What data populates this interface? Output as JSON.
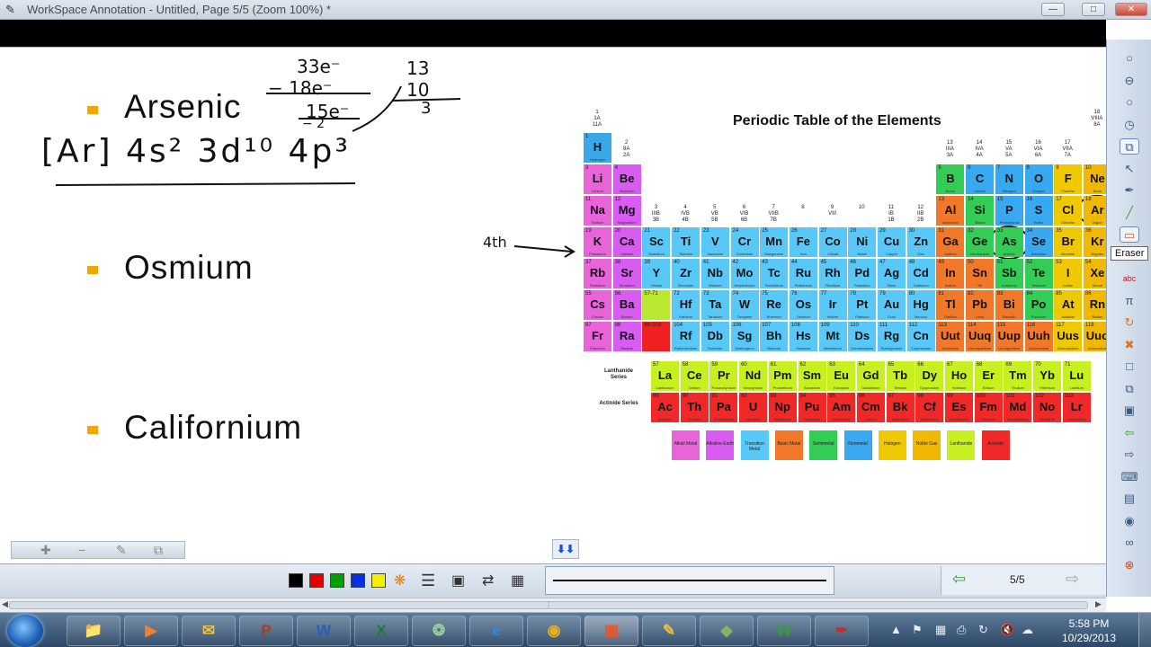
{
  "window": {
    "title": "WorkSpace Annotation - Untitled, Page 5/5  (Zoom 100%) *",
    "minimize": "—",
    "maximize": "□",
    "close": "✕"
  },
  "slide": {
    "bullets": [
      {
        "label": "Arsenic"
      },
      {
        "label": "Osmium"
      },
      {
        "label": "Californium"
      }
    ],
    "handwriting": {
      "calc_line1": "33e⁻",
      "calc_line2": "− 18e⁻",
      "calc_line3": "15e⁻",
      "calc_line4": "− 2",
      "group_line1": "13",
      "group_line2": "10",
      "group_line3": "3",
      "config": "[Ar] 4s² 3d¹⁰ 4p³",
      "period_mark": "4th"
    }
  },
  "periodic_table": {
    "title": "Periodic Table of the Elements",
    "group_labels": [
      {
        "g": "1\n1A\n11A"
      },
      {
        "g": "2\n8A\n2A"
      },
      {
        "g": "3\nIIIB\n3B"
      },
      {
        "g": "4\nIVB\n4B"
      },
      {
        "g": "5\nVB\n5B"
      },
      {
        "g": "6\nVIB\n6B"
      },
      {
        "g": "7\nVIIB\n7B"
      },
      {
        "g": "8"
      },
      {
        "g": "9\nVIII"
      },
      {
        "g": "10"
      },
      {
        "g": "11\nIB\n1B"
      },
      {
        "g": "12\nIIB\n2B"
      },
      {
        "g": "13\nIIIA\n3A"
      },
      {
        "g": "14\nIVA\n4A"
      },
      {
        "g": "15\nVA\n5A"
      },
      {
        "g": "16\nVIA\n6A"
      },
      {
        "g": "17\nVIIA\n7A"
      },
      {
        "g": "18\nVIIIA\n8A"
      }
    ],
    "elements": [
      {
        "n": "1",
        "s": "H",
        "name": "Hydrogen",
        "c": "#38a8e8"
      },
      {
        "n": "3",
        "s": "Li",
        "name": "Lithium",
        "c": "#e864d8"
      },
      {
        "n": "4",
        "s": "Be",
        "name": "Beryllium",
        "c": "#d85cf0"
      },
      {
        "n": "5",
        "s": "B",
        "name": "Boron",
        "c": "#33cc55"
      },
      {
        "n": "6",
        "s": "C",
        "name": "Carbon",
        "c": "#38a8f0"
      },
      {
        "n": "7",
        "s": "N",
        "name": "Nitrogen",
        "c": "#38a8f0"
      },
      {
        "n": "8",
        "s": "O",
        "name": "Oxygen",
        "c": "#38a8f0"
      },
      {
        "n": "9",
        "s": "F",
        "name": "Fluorine",
        "c": "#f0c800"
      },
      {
        "n": "10",
        "s": "Ne",
        "name": "Neon",
        "c": "#f0b800"
      },
      {
        "n": "11",
        "s": "Na",
        "name": "Sodium",
        "c": "#e864d8"
      },
      {
        "n": "12",
        "s": "Mg",
        "name": "Magnesium",
        "c": "#d85cf0"
      },
      {
        "n": "13",
        "s": "Al",
        "name": "Aluminum",
        "c": "#f07828"
      },
      {
        "n": "14",
        "s": "Si",
        "name": "Silicon",
        "c": "#33cc55"
      },
      {
        "n": "15",
        "s": "P",
        "name": "Phosphorus",
        "c": "#38a8f0"
      },
      {
        "n": "16",
        "s": "S",
        "name": "Sulfur",
        "c": "#38a8f0"
      },
      {
        "n": "17",
        "s": "Cl",
        "name": "Chlorine",
        "c": "#f0c800"
      },
      {
        "n": "18",
        "s": "Ar",
        "name": "Argon",
        "c": "#f0b800"
      },
      {
        "n": "19",
        "s": "K",
        "name": "Potassium",
        "c": "#e864d8"
      },
      {
        "n": "20",
        "s": "Ca",
        "name": "Calcium",
        "c": "#d85cf0"
      },
      {
        "n": "21",
        "s": "Sc",
        "name": "Scandium",
        "c": "#58c8f8"
      },
      {
        "n": "22",
        "s": "Ti",
        "name": "Titanium",
        "c": "#58c8f8"
      },
      {
        "n": "23",
        "s": "V",
        "name": "Vanadium",
        "c": "#58c8f8"
      },
      {
        "n": "24",
        "s": "Cr",
        "name": "Chromium",
        "c": "#58c8f8"
      },
      {
        "n": "25",
        "s": "Mn",
        "name": "Manganese",
        "c": "#58c8f8"
      },
      {
        "n": "26",
        "s": "Fe",
        "name": "Iron",
        "c": "#58c8f8"
      },
      {
        "n": "27",
        "s": "Co",
        "name": "Cobalt",
        "c": "#58c8f8"
      },
      {
        "n": "28",
        "s": "Ni",
        "name": "Nickel",
        "c": "#58c8f8"
      },
      {
        "n": "29",
        "s": "Cu",
        "name": "Copper",
        "c": "#58c8f8"
      },
      {
        "n": "30",
        "s": "Zn",
        "name": "Zinc",
        "c": "#58c8f8"
      },
      {
        "n": "31",
        "s": "Ga",
        "name": "Gallium",
        "c": "#f07828"
      },
      {
        "n": "32",
        "s": "Ge",
        "name": "Germanium",
        "c": "#33cc55"
      },
      {
        "n": "33",
        "s": "As",
        "name": "Arsenic",
        "c": "#33cc55"
      },
      {
        "n": "34",
        "s": "Se",
        "name": "Selenium",
        "c": "#38a8f0"
      },
      {
        "n": "35",
        "s": "Br",
        "name": "Bromine",
        "c": "#f0c800"
      },
      {
        "n": "36",
        "s": "Kr",
        "name": "Krypton",
        "c": "#f0b800"
      },
      {
        "n": "37",
        "s": "Rb",
        "name": "Rubidium",
        "c": "#e864d8"
      },
      {
        "n": "38",
        "s": "Sr",
        "name": "Strontium",
        "c": "#d85cf0"
      },
      {
        "n": "39",
        "s": "Y",
        "name": "Yttrium",
        "c": "#58c8f8"
      },
      {
        "n": "40",
        "s": "Zr",
        "name": "Zirconium",
        "c": "#58c8f8"
      },
      {
        "n": "41",
        "s": "Nb",
        "name": "Niobium",
        "c": "#58c8f8"
      },
      {
        "n": "42",
        "s": "Mo",
        "name": "Molybdenum",
        "c": "#58c8f8"
      },
      {
        "n": "43",
        "s": "Tc",
        "name": "Technetium",
        "c": "#58c8f8"
      },
      {
        "n": "44",
        "s": "Ru",
        "name": "Ruthenium",
        "c": "#58c8f8"
      },
      {
        "n": "45",
        "s": "Rh",
        "name": "Rhodium",
        "c": "#58c8f8"
      },
      {
        "n": "46",
        "s": "Pd",
        "name": "Palladium",
        "c": "#58c8f8"
      },
      {
        "n": "47",
        "s": "Ag",
        "name": "Silver",
        "c": "#58c8f8"
      },
      {
        "n": "48",
        "s": "Cd",
        "name": "Cadmium",
        "c": "#58c8f8"
      },
      {
        "n": "49",
        "s": "In",
        "name": "Indium",
        "c": "#f07828"
      },
      {
        "n": "50",
        "s": "Sn",
        "name": "Tin",
        "c": "#f07828"
      },
      {
        "n": "51",
        "s": "Sb",
        "name": "Antimony",
        "c": "#33cc55"
      },
      {
        "n": "52",
        "s": "Te",
        "name": "Tellurium",
        "c": "#33cc55"
      },
      {
        "n": "53",
        "s": "I",
        "name": "Iodine",
        "c": "#f0c800"
      },
      {
        "n": "54",
        "s": "Xe",
        "name": "Xenon",
        "c": "#f0b800"
      },
      {
        "n": "55",
        "s": "Cs",
        "name": "Cesium",
        "c": "#e864d8"
      },
      {
        "n": "56",
        "s": "Ba",
        "name": "Barium",
        "c": "#d85cf0"
      },
      {
        "n": "57-71",
        "s": "",
        "name": "",
        "c": "#b8e830"
      },
      {
        "n": "72",
        "s": "Hf",
        "name": "Hafnium",
        "c": "#58c8f8"
      },
      {
        "n": "73",
        "s": "Ta",
        "name": "Tantalum",
        "c": "#58c8f8"
      },
      {
        "n": "74",
        "s": "W",
        "name": "Tungsten",
        "c": "#58c8f8"
      },
      {
        "n": "75",
        "s": "Re",
        "name": "Rhenium",
        "c": "#58c8f8"
      },
      {
        "n": "76",
        "s": "Os",
        "name": "Osmium",
        "c": "#58c8f8"
      },
      {
        "n": "77",
        "s": "Ir",
        "name": "Iridium",
        "c": "#58c8f8"
      },
      {
        "n": "78",
        "s": "Pt",
        "name": "Platinum",
        "c": "#58c8f8"
      },
      {
        "n": "79",
        "s": "Au",
        "name": "Gold",
        "c": "#58c8f8"
      },
      {
        "n": "80",
        "s": "Hg",
        "name": "Mercury",
        "c": "#58c8f8"
      },
      {
        "n": "81",
        "s": "Tl",
        "name": "Thallium",
        "c": "#f07828"
      },
      {
        "n": "82",
        "s": "Pb",
        "name": "Lead",
        "c": "#f07828"
      },
      {
        "n": "83",
        "s": "Bi",
        "name": "Bismuth",
        "c": "#f07828"
      },
      {
        "n": "84",
        "s": "Po",
        "name": "Polonium",
        "c": "#33cc55"
      },
      {
        "n": "85",
        "s": "At",
        "name": "Astatine",
        "c": "#f0c800"
      },
      {
        "n": "86",
        "s": "Rn",
        "name": "Radon",
        "c": "#f0b800"
      },
      {
        "n": "87",
        "s": "Fr",
        "name": "Francium",
        "c": "#e864d8"
      },
      {
        "n": "88",
        "s": "Ra",
        "name": "Radium",
        "c": "#d85cf0"
      },
      {
        "n": "89-103",
        "s": "",
        "name": "",
        "c": "#ee2020"
      },
      {
        "n": "104",
        "s": "Rf",
        "name": "Rutherfordium",
        "c": "#58c8f8"
      },
      {
        "n": "105",
        "s": "Db",
        "name": "Dubnium",
        "c": "#58c8f8"
      },
      {
        "n": "106",
        "s": "Sg",
        "name": "Seaborgium",
        "c": "#58c8f8"
      },
      {
        "n": "107",
        "s": "Bh",
        "name": "Bohrium",
        "c": "#58c8f8"
      },
      {
        "n": "108",
        "s": "Hs",
        "name": "Hassium",
        "c": "#58c8f8"
      },
      {
        "n": "109",
        "s": "Mt",
        "name": "Meitnerium",
        "c": "#58c8f8"
      },
      {
        "n": "110",
        "s": "Ds",
        "name": "Darmstadtium",
        "c": "#58c8f8"
      },
      {
        "n": "111",
        "s": "Rg",
        "name": "Roentgenium",
        "c": "#58c8f8"
      },
      {
        "n": "112",
        "s": "Cn",
        "name": "Copernicium",
        "c": "#58c8f8"
      },
      {
        "n": "113",
        "s": "Uut",
        "name": "Ununtrium",
        "c": "#f07828"
      },
      {
        "n": "114",
        "s": "Uuq",
        "name": "Ununquadium",
        "c": "#f07828"
      },
      {
        "n": "115",
        "s": "Uup",
        "name": "Ununpentium",
        "c": "#f07828"
      },
      {
        "n": "116",
        "s": "Uuh",
        "name": "Ununhexium",
        "c": "#f07828"
      },
      {
        "n": "117",
        "s": "Uus",
        "name": "Ununseptium",
        "c": "#f0c800"
      },
      {
        "n": "118",
        "s": "Uuo",
        "name": "Ununoctium",
        "c": "#f0b800"
      }
    ],
    "lanthanide_label": "Lanthanide Series",
    "actinide_label": "Actinide Series",
    "lanthanides": [
      {
        "n": "57",
        "s": "La",
        "name": "Lanthanum"
      },
      {
        "n": "58",
        "s": "Ce",
        "name": "Cerium"
      },
      {
        "n": "59",
        "s": "Pr",
        "name": "Praseodymium"
      },
      {
        "n": "60",
        "s": "Nd",
        "name": "Neodymium"
      },
      {
        "n": "61",
        "s": "Pm",
        "name": "Promethium"
      },
      {
        "n": "62",
        "s": "Sm",
        "name": "Samarium"
      },
      {
        "n": "63",
        "s": "Eu",
        "name": "Europium"
      },
      {
        "n": "64",
        "s": "Gd",
        "name": "Gadolinium"
      },
      {
        "n": "65",
        "s": "Tb",
        "name": "Terbium"
      },
      {
        "n": "66",
        "s": "Dy",
        "name": "Dysprosium"
      },
      {
        "n": "67",
        "s": "Ho",
        "name": "Holmium"
      },
      {
        "n": "68",
        "s": "Er",
        "name": "Erbium"
      },
      {
        "n": "69",
        "s": "Tm",
        "name": "Thulium"
      },
      {
        "n": "70",
        "s": "Yb",
        "name": "Ytterbium"
      },
      {
        "n": "71",
        "s": "Lu",
        "name": "Lutetium"
      }
    ],
    "actinides": [
      {
        "n": "89",
        "s": "Ac",
        "name": "Actinium"
      },
      {
        "n": "90",
        "s": "Th",
        "name": "Thorium"
      },
      {
        "n": "91",
        "s": "Pa",
        "name": "Protactinium"
      },
      {
        "n": "92",
        "s": "U",
        "name": "Uranium"
      },
      {
        "n": "93",
        "s": "Np",
        "name": "Neptunium"
      },
      {
        "n": "94",
        "s": "Pu",
        "name": "Plutonium"
      },
      {
        "n": "95",
        "s": "Am",
        "name": "Americium"
      },
      {
        "n": "96",
        "s": "Cm",
        "name": "Curium"
      },
      {
        "n": "97",
        "s": "Bk",
        "name": "Berkelium"
      },
      {
        "n": "98",
        "s": "Cf",
        "name": "Californium"
      },
      {
        "n": "99",
        "s": "Es",
        "name": "Einsteinium"
      },
      {
        "n": "100",
        "s": "Fm",
        "name": "Fermium"
      },
      {
        "n": "101",
        "s": "Md",
        "name": "Mendelevium"
      },
      {
        "n": "102",
        "s": "No",
        "name": "Nobelium"
      },
      {
        "n": "103",
        "s": "Lr",
        "name": "Lawrencium"
      }
    ],
    "lanthanide_color": "#c8f020",
    "actinide_color": "#f02828",
    "legend": [
      {
        "label": "Alkali Metal",
        "c": "#e864d8"
      },
      {
        "label": "Alkaline Earth",
        "c": "#d85cf0"
      },
      {
        "label": "Transition Metal",
        "c": "#58c8f8"
      },
      {
        "label": "Basic Metal",
        "c": "#f07828"
      },
      {
        "label": "Semimetal",
        "c": "#33cc55"
      },
      {
        "label": "Nonmetal",
        "c": "#38a8f0"
      },
      {
        "label": "Halogen",
        "c": "#f0c800"
      },
      {
        "label": "Noble Gas",
        "c": "#f0b800"
      },
      {
        "label": "Lanthanide",
        "c": "#c8f020"
      },
      {
        "label": "Actinide",
        "c": "#f02828"
      }
    ]
  },
  "right_toolbar": {
    "tooltip": "Eraser",
    "tools": [
      "circle-icon",
      "minus-icon",
      "circle-icon",
      "clock-icon",
      "copy-icon",
      "cursor-icon",
      "pen-icon",
      "marker-icon",
      "eraser-icon",
      "lines-icon",
      "text-abc-icon",
      "symbol-icon",
      "refresh-icon",
      "cross-icon",
      "page-icon",
      "pages-icon",
      "screenshot-icon",
      "back-arrow-icon",
      "forward-arrow-icon",
      "keyboard-icon",
      "display-icon",
      "camera-icon",
      "link-icon",
      "close-icon"
    ]
  },
  "mini_toolbar": {
    "add": "✚",
    "remove": "−",
    "edit": "✎",
    "clone": "⧉"
  },
  "bottom_toolbar": {
    "colors": [
      "#000000",
      "#e00000",
      "#00a000",
      "#0030e0",
      "#f0f000"
    ],
    "page_indicator": "5/5"
  },
  "taskbar": {
    "clock_time": "5:58 PM",
    "clock_date": "10/29/2013",
    "apps": [
      {
        "name": "explorer",
        "glyph": "📁",
        "c": "#f0c048"
      },
      {
        "name": "media-player",
        "glyph": "▶",
        "c": "#f08030"
      },
      {
        "name": "outlook",
        "glyph": "✉",
        "c": "#f0c040"
      },
      {
        "name": "powerpoint",
        "glyph": "P",
        "c": "#b03a1a"
      },
      {
        "name": "word",
        "glyph": "W",
        "c": "#2a5bb8"
      },
      {
        "name": "excel",
        "glyph": "X",
        "c": "#1e7a36"
      },
      {
        "name": "loading",
        "glyph": "❂",
        "c": "#9ad0a0"
      },
      {
        "name": "internet-explorer",
        "glyph": "e",
        "c": "#2f8ae0"
      },
      {
        "name": "chrome",
        "glyph": "◉",
        "c": "#e8b020"
      },
      {
        "name": "annotation-app",
        "glyph": "▣",
        "c": "#e05830"
      },
      {
        "name": "notes",
        "glyph": "✎",
        "c": "#e8c040"
      },
      {
        "name": "tool-green",
        "glyph": "◆",
        "c": "#8ab060"
      },
      {
        "name": "workspace",
        "glyph": "W",
        "c": "#3a9a3a"
      },
      {
        "name": "pen-tool",
        "glyph": "✒",
        "c": "#c03030"
      }
    ]
  }
}
